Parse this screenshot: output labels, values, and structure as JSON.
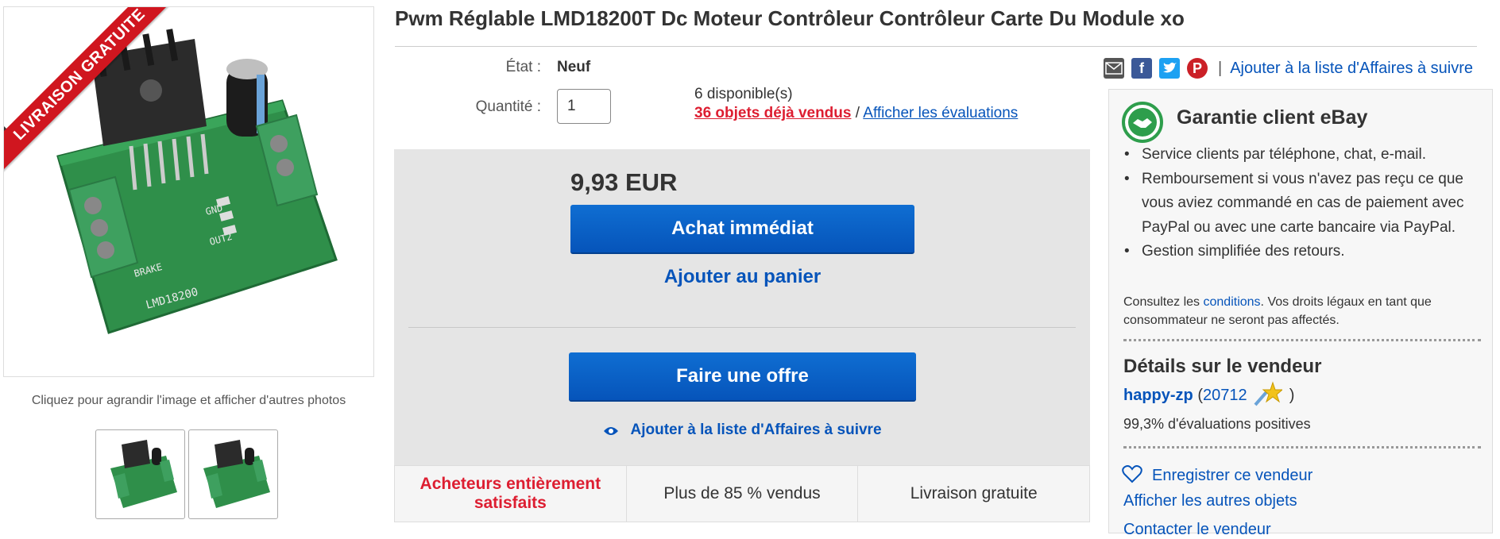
{
  "product": {
    "ribbon": "LIVRAISON GRATUITE",
    "image_caption": "Cliquez pour agrandir l'image et afficher d'autres photos",
    "title": "Pwm Réglable LMD18200T Dc Moteur Contrôleur Contrôleur Carte Du Module xo"
  },
  "details": {
    "etat_label": "État :",
    "etat_value": "Neuf",
    "quantity_label": "Quantité :",
    "quantity_value": "1",
    "available": "6 disponible(s)",
    "sold_link": "36 objets déjà vendus",
    "separator": "/",
    "reviews_link": "Afficher les évaluations"
  },
  "buy": {
    "price": "9,93 EUR",
    "buy_now": "Achat immédiat",
    "add_to_cart": "Ajouter au panier",
    "make_offer": "Faire une offre",
    "watch": "Ajouter à la liste d'Affaires à suivre"
  },
  "features": [
    "Acheteurs entièrement satisfaits",
    "Plus de 85 % vendus",
    "Livraison gratuite"
  ],
  "share": {
    "icons": [
      "email-icon",
      "facebook-icon",
      "twitter-icon",
      "pinterest-icon"
    ],
    "separator": "|",
    "watch_link": "Ajouter à la liste d'Affaires à suivre"
  },
  "guarantee": {
    "title": "Garantie client eBay",
    "bullets": [
      "Service clients par téléphone, chat, e-mail.",
      "Remboursement si vous n'avez pas reçu ce que vous aviez commandé en cas de paiement avec PayPal ou avec une carte bancaire via PayPal.",
      "Gestion simplifiée des retours."
    ],
    "legal_pre": "Consultez les ",
    "legal_link": "conditions",
    "legal_post": ". Vos droits légaux en tant que consommateur ne seront pas affectés."
  },
  "seller": {
    "title": "Détails sur le vendeur",
    "name": "happy-zp",
    "open_paren": " (",
    "score": "20712",
    "close_paren": " )",
    "feedback": "99,3% d'évaluations positives",
    "save": "Enregistrer ce vendeur",
    "other_items": "Afficher les autres objets",
    "contact": "Contacter le vendeur"
  },
  "colors": {
    "link": "#0654ba",
    "button": "#0654ba",
    "red": "#dd1e31",
    "buybox_bg": "#e5e5e5",
    "pcb_green": "#2f8f4a"
  }
}
